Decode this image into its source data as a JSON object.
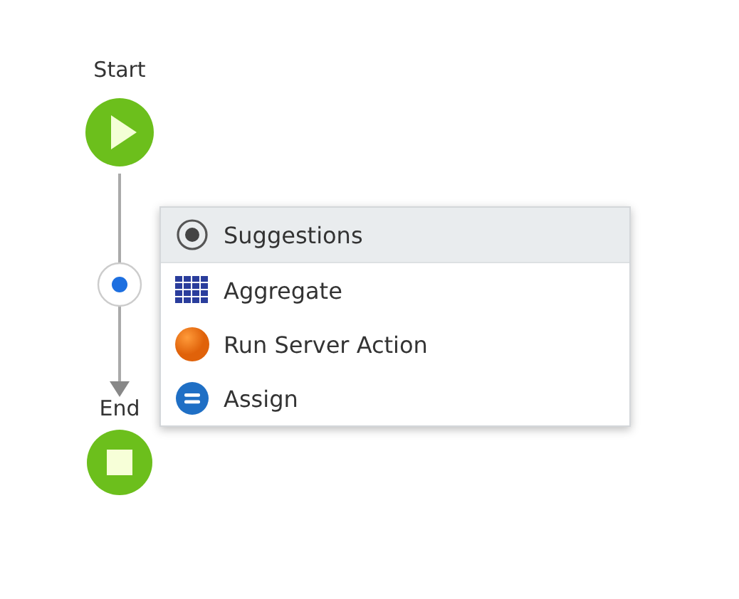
{
  "flow": {
    "start": {
      "label": "Start"
    },
    "end": {
      "label": "End"
    }
  },
  "menu": {
    "items": [
      {
        "kind": "header",
        "label": "Suggestions"
      },
      {
        "kind": "aggregate",
        "label": "Aggregate"
      },
      {
        "kind": "server-action",
        "label": "Run Server Action"
      },
      {
        "kind": "assign",
        "label": "Assign"
      }
    ]
  }
}
